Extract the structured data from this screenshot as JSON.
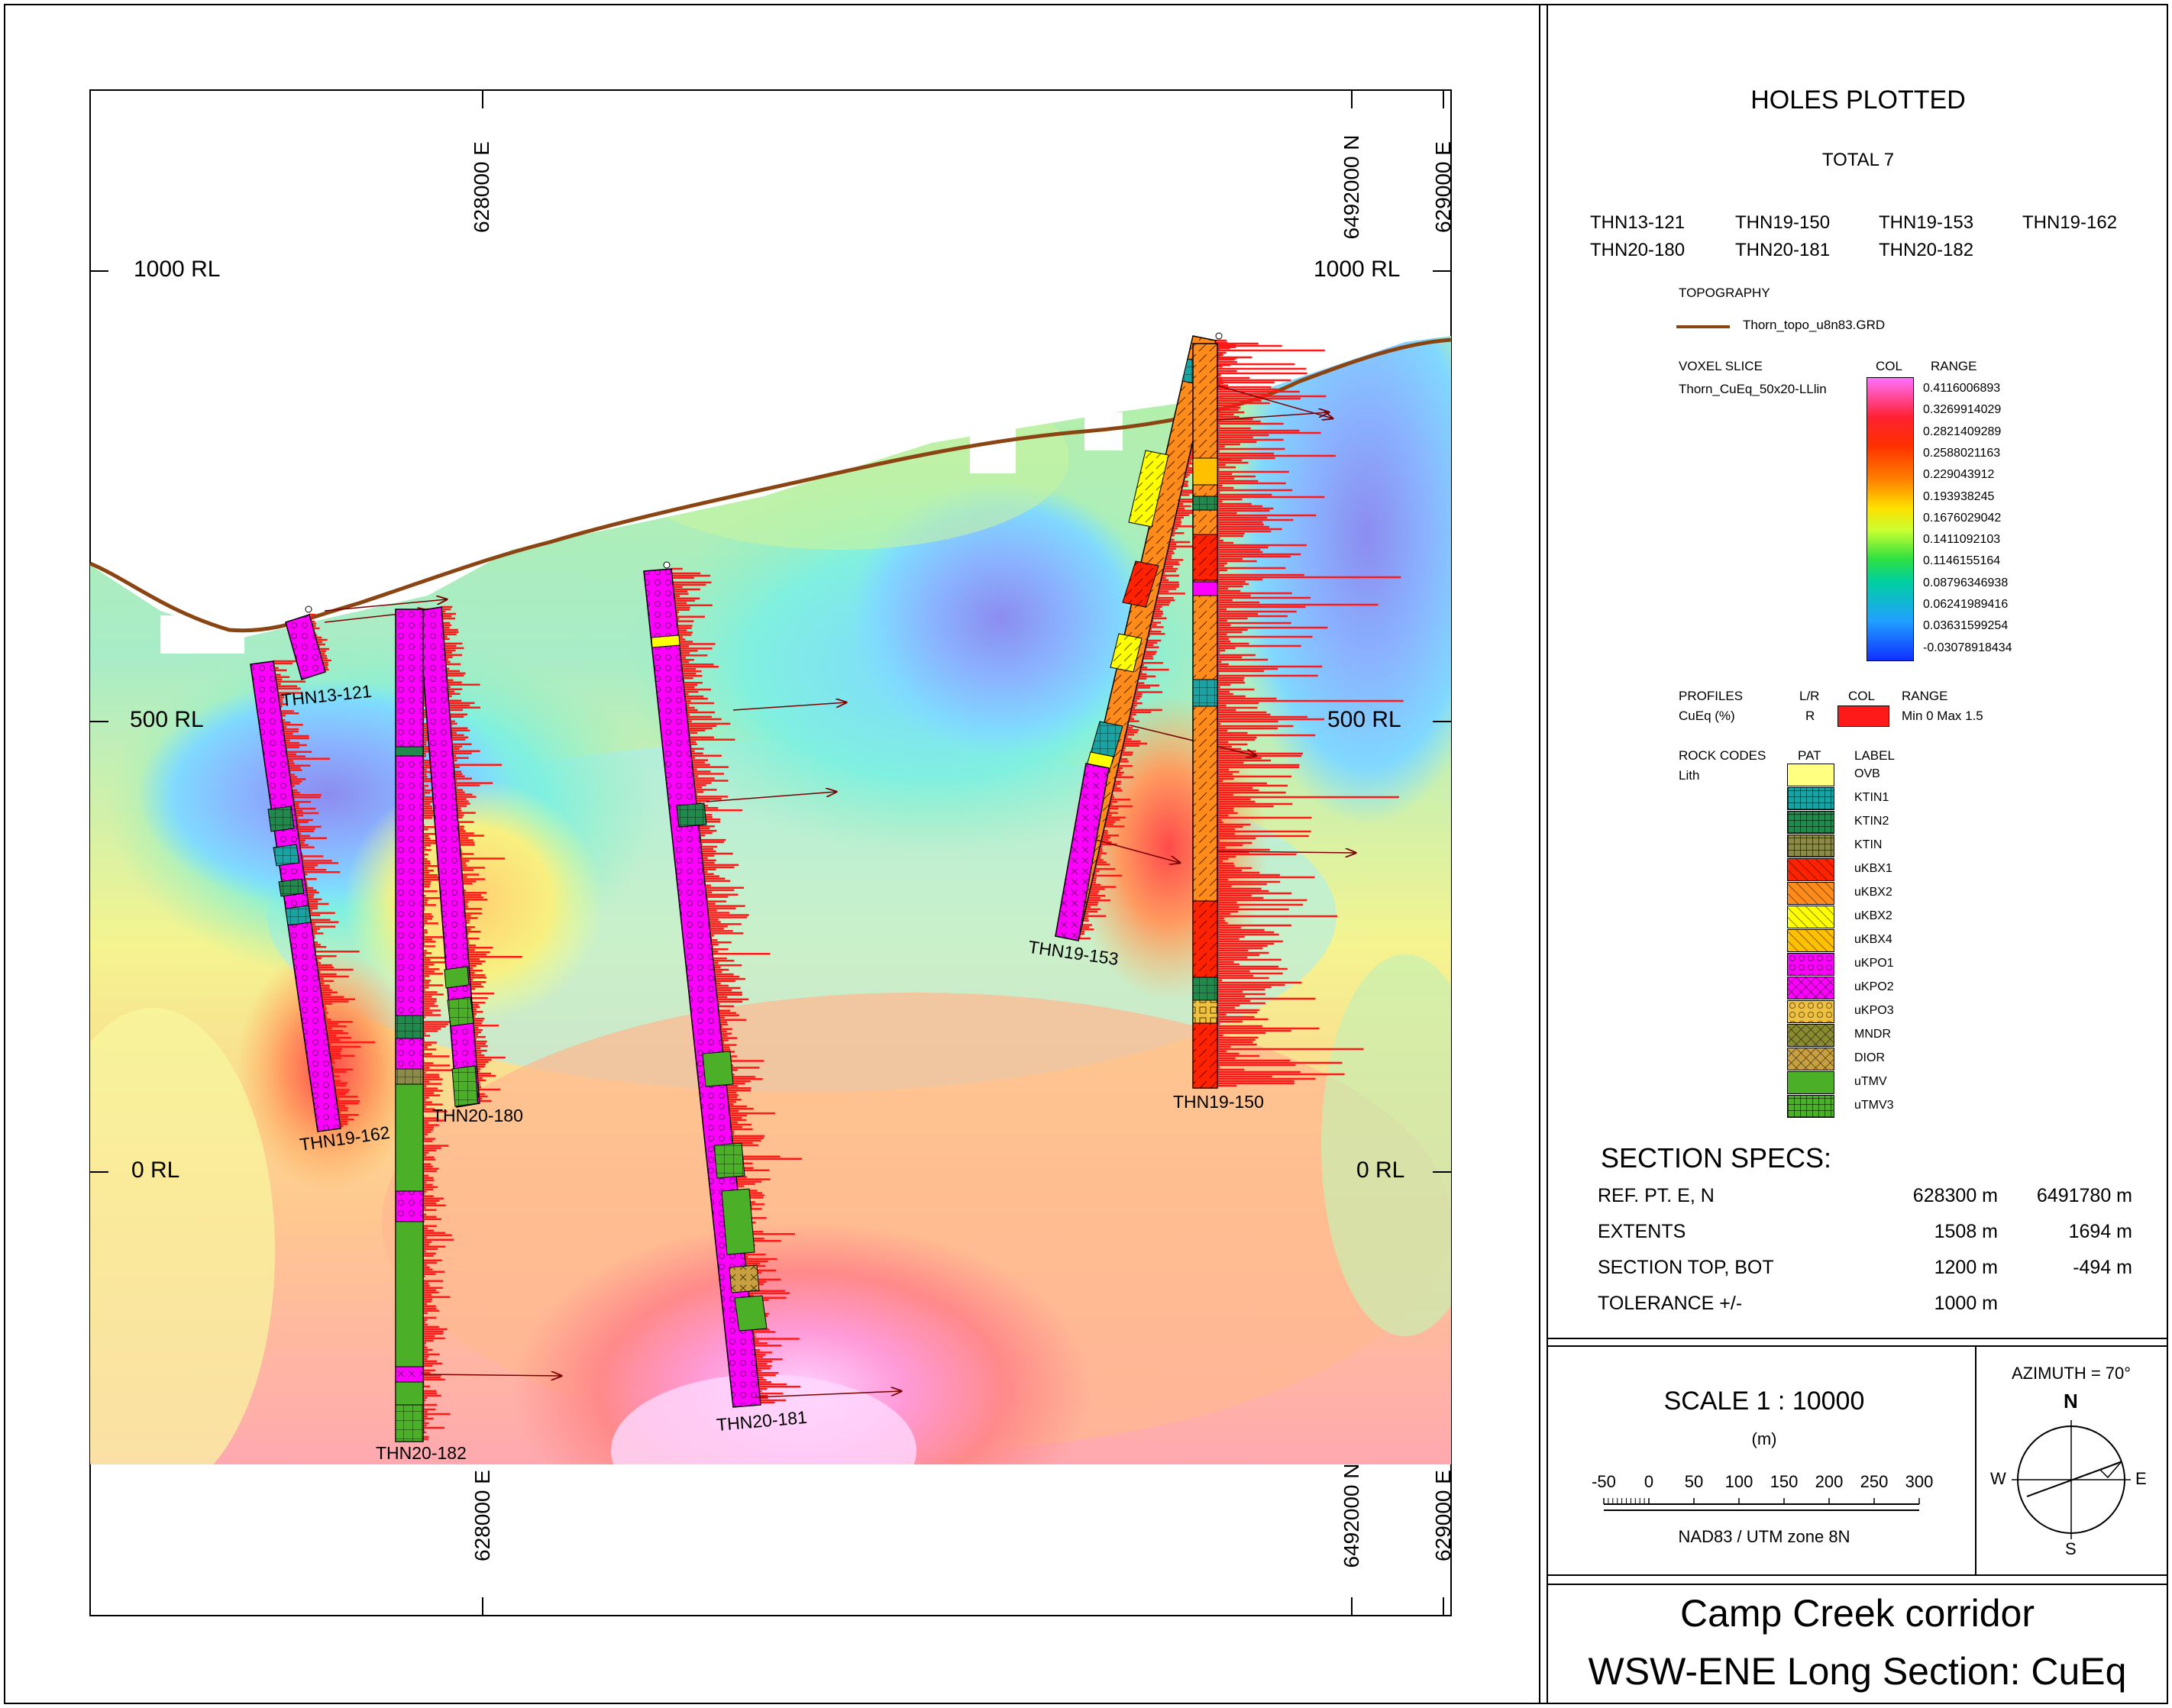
{
  "section": {
    "rl_labels": [
      "1000 RL",
      "500 RL",
      "0 RL"
    ],
    "east_labels": [
      "628000 E",
      "629000 E"
    ],
    "north_label": "6492000 N",
    "holes": [
      {
        "id": "THN13-121",
        "label": "THN13-121"
      },
      {
        "id": "THN19-162",
        "label": "THN19-162"
      },
      {
        "id": "THN20-180",
        "label": "THN20-180"
      },
      {
        "id": "THN20-182",
        "label": "THN20-182"
      },
      {
        "id": "THN20-181",
        "label": "THN20-181"
      },
      {
        "id": "THN19-153",
        "label": "THN19-153"
      },
      {
        "id": "THN19-150",
        "label": "THN19-150"
      }
    ]
  },
  "holes_plotted": {
    "title": "HOLES PLOTTED",
    "total": "TOTAL 7",
    "list": [
      "THN13-121",
      "THN19-150",
      "THN19-153",
      "THN19-162",
      "THN20-180",
      "THN20-181",
      "THN20-182"
    ]
  },
  "topography": {
    "heading": "TOPOGRAPHY",
    "file": "Thorn_topo_u8n83.GRD",
    "color": "#8b4513"
  },
  "voxel": {
    "heading": "VOXEL SLICE",
    "file": "Thorn_CuEq_50x20-LLlin",
    "col_header": "COL",
    "range_header": "RANGE",
    "ranges": [
      "0.4116006893",
      "0.3269914029",
      "0.2821409289",
      "0.2588021163",
      "0.229043912",
      "0.193938245",
      "0.1676029042",
      "0.1411092103",
      "0.1146155164",
      "0.08796346938",
      "0.06241989416",
      "0.03631599254",
      "-0.03078918434"
    ]
  },
  "profiles": {
    "heading": "PROFILES",
    "lr_header": "L/R",
    "col_header": "COL",
    "range_header": "RANGE",
    "name": "CuEq (%)",
    "side": "R",
    "range_text": "Min 0  Max 1.5",
    "color": "#ff1a1a"
  },
  "rock_codes": {
    "heading": "ROCK CODES",
    "pat_header": "PAT",
    "label_header": "LABEL",
    "sub": "Lith",
    "items": [
      {
        "label": "OVB",
        "color": "#ffff80",
        "pattern": "plain"
      },
      {
        "label": "KTIN1",
        "color": "#1aa3a3",
        "pattern": "grid"
      },
      {
        "label": "KTIN2",
        "color": "#1f8a4c",
        "pattern": "grid"
      },
      {
        "label": "KTIN",
        "color": "#8a8a4a",
        "pattern": "grid"
      },
      {
        "label": "uKBX1",
        "color": "#ff2200",
        "pattern": "hatch"
      },
      {
        "label": "uKBX2",
        "color": "#ff8c1a",
        "pattern": "hatch"
      },
      {
        "label": "uKBX2",
        "color": "#ffff00",
        "pattern": "hatch"
      },
      {
        "label": "uKBX4",
        "color": "#ffc000",
        "pattern": "hatch"
      },
      {
        "label": "uKPO1",
        "color": "#ff00ff",
        "pattern": "circles"
      },
      {
        "label": "uKPO2",
        "color": "#ff00ff",
        "pattern": "cross"
      },
      {
        "label": "uKPO3",
        "color": "#f0c040",
        "pattern": "circles"
      },
      {
        "label": "MNDR",
        "color": "#8a8a30",
        "pattern": "cross"
      },
      {
        "label": "DIOR",
        "color": "#c8a040",
        "pattern": "cross"
      },
      {
        "label": "uTMV",
        "color": "#4caf28",
        "pattern": "plain"
      },
      {
        "label": "uTMV3",
        "color": "#4caf28",
        "pattern": "grid"
      }
    ]
  },
  "section_specs": {
    "title": "SECTION  SPECS:",
    "rows": [
      {
        "label": "REF. PT.  E, N",
        "v1": "628300 m",
        "v2": "6491780 m"
      },
      {
        "label": "EXTENTS",
        "v1": "1508 m",
        "v2": "1694 m"
      },
      {
        "label": "SECTION TOP, BOT",
        "v1": "1200 m",
        "v2": "-494 m"
      },
      {
        "label": "TOLERANCE  +/-",
        "v1": "1000 m",
        "v2": ""
      }
    ]
  },
  "scale": {
    "text": "SCALE  1 : 10000",
    "unit": "(m)",
    "ticks": [
      "-50",
      "0",
      "50",
      "100",
      "150",
      "200",
      "250",
      "300"
    ],
    "datum": "NAD83 / UTM zone 8N"
  },
  "azimuth": {
    "text": "AZIMUTH = 70°",
    "n": "N",
    "s": "S",
    "e": "E",
    "w": "W"
  },
  "title_block": {
    "line1": "Camp Creek corridor",
    "line2": "WSW-ENE Long Section:  CuEq"
  }
}
